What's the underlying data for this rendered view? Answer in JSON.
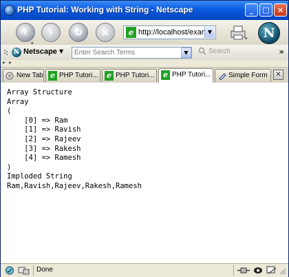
{
  "window": {
    "title": "PHP Tutorial: Working with String - Netscape",
    "controls": {
      "minimize": "_",
      "maximize": "□",
      "close": "×"
    }
  },
  "navigation": {
    "address": "http://localhost/example",
    "icons": [
      "back-icon",
      "forward-icon",
      "reload-icon",
      "stop-icon",
      "print-icon",
      "netscape-logo-icon"
    ]
  },
  "search_toolbar": {
    "brand_label": "Netscape",
    "search_placeholder": "Enter Search Terms",
    "search_button": "Search"
  },
  "tabs": [
    {
      "label": "New Tab",
      "active": false
    },
    {
      "label": "PHP Tutori...",
      "active": false
    },
    {
      "label": "PHP Tutori...",
      "active": false
    },
    {
      "label": "PHP Tutori...",
      "active": true
    },
    {
      "label": "Simple Form",
      "active": false
    }
  ],
  "content": {
    "lines": [
      "Array Structure",
      "Array",
      "(",
      "    [0] => Ram",
      "    [1] => Ravish",
      "    [2] => Rajeev",
      "    [3] => Rakesh",
      "    [4] => Ramesh",
      ")",
      "Imploded String",
      "Ram,Ravish,Rajeev,Rakesh,Ramesh"
    ]
  },
  "status": {
    "text": "Done"
  },
  "colors": {
    "titlebar": "#0a5ae0",
    "ie_icon": "#22a022"
  }
}
